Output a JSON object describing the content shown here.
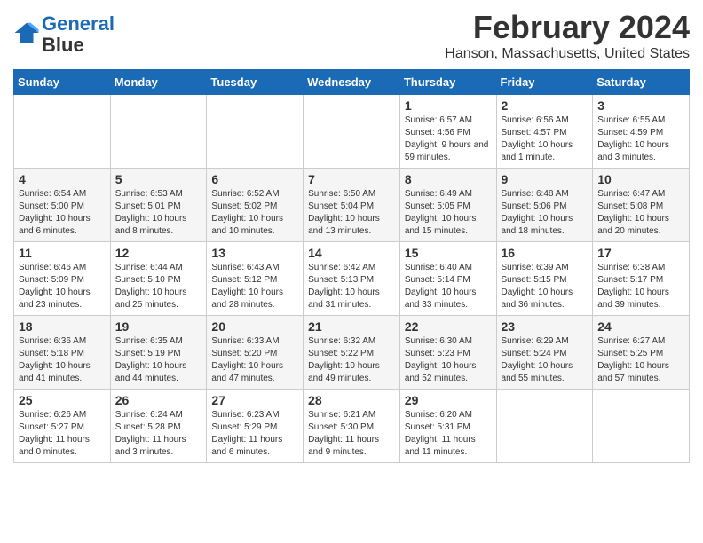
{
  "header": {
    "logo_line1": "General",
    "logo_line2": "Blue",
    "title": "February 2024",
    "subtitle": "Hanson, Massachusetts, United States"
  },
  "days_of_week": [
    "Sunday",
    "Monday",
    "Tuesday",
    "Wednesday",
    "Thursday",
    "Friday",
    "Saturday"
  ],
  "weeks": [
    [
      {
        "day": "",
        "info": ""
      },
      {
        "day": "",
        "info": ""
      },
      {
        "day": "",
        "info": ""
      },
      {
        "day": "",
        "info": ""
      },
      {
        "day": "1",
        "info": "Sunrise: 6:57 AM\nSunset: 4:56 PM\nDaylight: 9 hours and 59 minutes."
      },
      {
        "day": "2",
        "info": "Sunrise: 6:56 AM\nSunset: 4:57 PM\nDaylight: 10 hours and 1 minute."
      },
      {
        "day": "3",
        "info": "Sunrise: 6:55 AM\nSunset: 4:59 PM\nDaylight: 10 hours and 3 minutes."
      }
    ],
    [
      {
        "day": "4",
        "info": "Sunrise: 6:54 AM\nSunset: 5:00 PM\nDaylight: 10 hours and 6 minutes."
      },
      {
        "day": "5",
        "info": "Sunrise: 6:53 AM\nSunset: 5:01 PM\nDaylight: 10 hours and 8 minutes."
      },
      {
        "day": "6",
        "info": "Sunrise: 6:52 AM\nSunset: 5:02 PM\nDaylight: 10 hours and 10 minutes."
      },
      {
        "day": "7",
        "info": "Sunrise: 6:50 AM\nSunset: 5:04 PM\nDaylight: 10 hours and 13 minutes."
      },
      {
        "day": "8",
        "info": "Sunrise: 6:49 AM\nSunset: 5:05 PM\nDaylight: 10 hours and 15 minutes."
      },
      {
        "day": "9",
        "info": "Sunrise: 6:48 AM\nSunset: 5:06 PM\nDaylight: 10 hours and 18 minutes."
      },
      {
        "day": "10",
        "info": "Sunrise: 6:47 AM\nSunset: 5:08 PM\nDaylight: 10 hours and 20 minutes."
      }
    ],
    [
      {
        "day": "11",
        "info": "Sunrise: 6:46 AM\nSunset: 5:09 PM\nDaylight: 10 hours and 23 minutes."
      },
      {
        "day": "12",
        "info": "Sunrise: 6:44 AM\nSunset: 5:10 PM\nDaylight: 10 hours and 25 minutes."
      },
      {
        "day": "13",
        "info": "Sunrise: 6:43 AM\nSunset: 5:12 PM\nDaylight: 10 hours and 28 minutes."
      },
      {
        "day": "14",
        "info": "Sunrise: 6:42 AM\nSunset: 5:13 PM\nDaylight: 10 hours and 31 minutes."
      },
      {
        "day": "15",
        "info": "Sunrise: 6:40 AM\nSunset: 5:14 PM\nDaylight: 10 hours and 33 minutes."
      },
      {
        "day": "16",
        "info": "Sunrise: 6:39 AM\nSunset: 5:15 PM\nDaylight: 10 hours and 36 minutes."
      },
      {
        "day": "17",
        "info": "Sunrise: 6:38 AM\nSunset: 5:17 PM\nDaylight: 10 hours and 39 minutes."
      }
    ],
    [
      {
        "day": "18",
        "info": "Sunrise: 6:36 AM\nSunset: 5:18 PM\nDaylight: 10 hours and 41 minutes."
      },
      {
        "day": "19",
        "info": "Sunrise: 6:35 AM\nSunset: 5:19 PM\nDaylight: 10 hours and 44 minutes."
      },
      {
        "day": "20",
        "info": "Sunrise: 6:33 AM\nSunset: 5:20 PM\nDaylight: 10 hours and 47 minutes."
      },
      {
        "day": "21",
        "info": "Sunrise: 6:32 AM\nSunset: 5:22 PM\nDaylight: 10 hours and 49 minutes."
      },
      {
        "day": "22",
        "info": "Sunrise: 6:30 AM\nSunset: 5:23 PM\nDaylight: 10 hours and 52 minutes."
      },
      {
        "day": "23",
        "info": "Sunrise: 6:29 AM\nSunset: 5:24 PM\nDaylight: 10 hours and 55 minutes."
      },
      {
        "day": "24",
        "info": "Sunrise: 6:27 AM\nSunset: 5:25 PM\nDaylight: 10 hours and 57 minutes."
      }
    ],
    [
      {
        "day": "25",
        "info": "Sunrise: 6:26 AM\nSunset: 5:27 PM\nDaylight: 11 hours and 0 minutes."
      },
      {
        "day": "26",
        "info": "Sunrise: 6:24 AM\nSunset: 5:28 PM\nDaylight: 11 hours and 3 minutes."
      },
      {
        "day": "27",
        "info": "Sunrise: 6:23 AM\nSunset: 5:29 PM\nDaylight: 11 hours and 6 minutes."
      },
      {
        "day": "28",
        "info": "Sunrise: 6:21 AM\nSunset: 5:30 PM\nDaylight: 11 hours and 9 minutes."
      },
      {
        "day": "29",
        "info": "Sunrise: 6:20 AM\nSunset: 5:31 PM\nDaylight: 11 hours and 11 minutes."
      },
      {
        "day": "",
        "info": ""
      },
      {
        "day": "",
        "info": ""
      }
    ]
  ]
}
